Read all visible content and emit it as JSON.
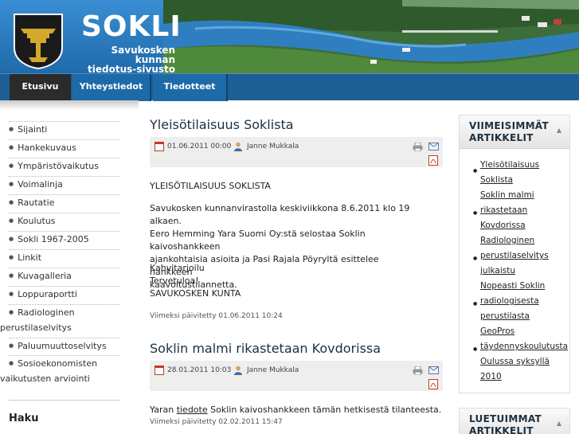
{
  "header": {
    "title": "SOKLI",
    "subtitle_line1": "Savukosken kunnan",
    "subtitle_line2": "tiedotus-sivusto"
  },
  "nav": {
    "tabs": [
      {
        "label": "Etusivu",
        "active": true
      },
      {
        "label": "Yhteystiedot",
        "active": false
      },
      {
        "label": "Tiedotteet",
        "active": false
      }
    ]
  },
  "sidebar": {
    "items": [
      {
        "label": "Sijainti"
      },
      {
        "label": "Hankekuvaus"
      },
      {
        "label": "Ympäristövaikutus"
      },
      {
        "label": "Voimalinja"
      },
      {
        "label": "Rautatie"
      },
      {
        "label": "Koulutus"
      },
      {
        "label": "Sokli 1967-2005"
      },
      {
        "label": "Linkit"
      },
      {
        "label": "Kuvagalleria"
      },
      {
        "label": "Loppuraportti"
      },
      {
        "label": "Radiologinen",
        "label2": "perustilaselvitys"
      },
      {
        "label": "Paluumuuttoselvitys"
      },
      {
        "label": "Sosioekonomisten",
        "label2": "vaikutusten arviointi"
      }
    ],
    "search_title": "Haku"
  },
  "articles": [
    {
      "title": "Yleisötilaisuus Soklista",
      "date": "01.06.2011 00:00",
      "author": "Janne Mukkala",
      "heading": "YLEISÖTILAISUUS SOKLISTA",
      "para1": [
        "Savukosken kunnanvirastolla keskiviikkona 8.6.2011 klo 19 alkaen.",
        "Eero Hemming Yara Suomi Oy:stä selostaa Soklin kaivoshankkeen",
        "ajankohtaisia asioita ja Pasi Rajala Pöyryltä esittelee hankkeen",
        "kaavoitustilannetta."
      ],
      "para2": [
        "Kahvitarjoilu",
        "Tervetuloa!",
        "SAVUKOSKEN KUNTA"
      ],
      "updated": "Viimeksi päivitetty 01.06.2011 10:24"
    },
    {
      "title": "Soklin malmi rikastetaan Kovdorissa",
      "date": "28.01.2011 10:03",
      "author": "Janne Mukkala",
      "text_before": "Yaran ",
      "link": "tiedote",
      "text_after": " Soklin kaivoshankkeen tämän hetkisestä tilanteesta.",
      "updated": "Viimeksi päivitetty 02.02.2011 15:47"
    }
  ],
  "widgets": {
    "latest": {
      "title1": "VIIMEISIMMÄT",
      "title2": "ARTIKKELIT",
      "lines": [
        "Yleisötilaisuus",
        "Soklista",
        "Soklin malmi",
        "rikastetaan",
        "Kovdorissa",
        "Radiologinen",
        "perustilaselvitys",
        "julkaistu",
        "Nopeasti Soklin",
        "radiologisesta",
        "perustilasta",
        "GeoPros",
        "täydennyskoulutusta",
        "Oulussa syksyllä",
        "2010"
      ]
    },
    "most_read": {
      "title1": "LUETUIMMAT",
      "title2": "ARTIKKELIT"
    }
  }
}
